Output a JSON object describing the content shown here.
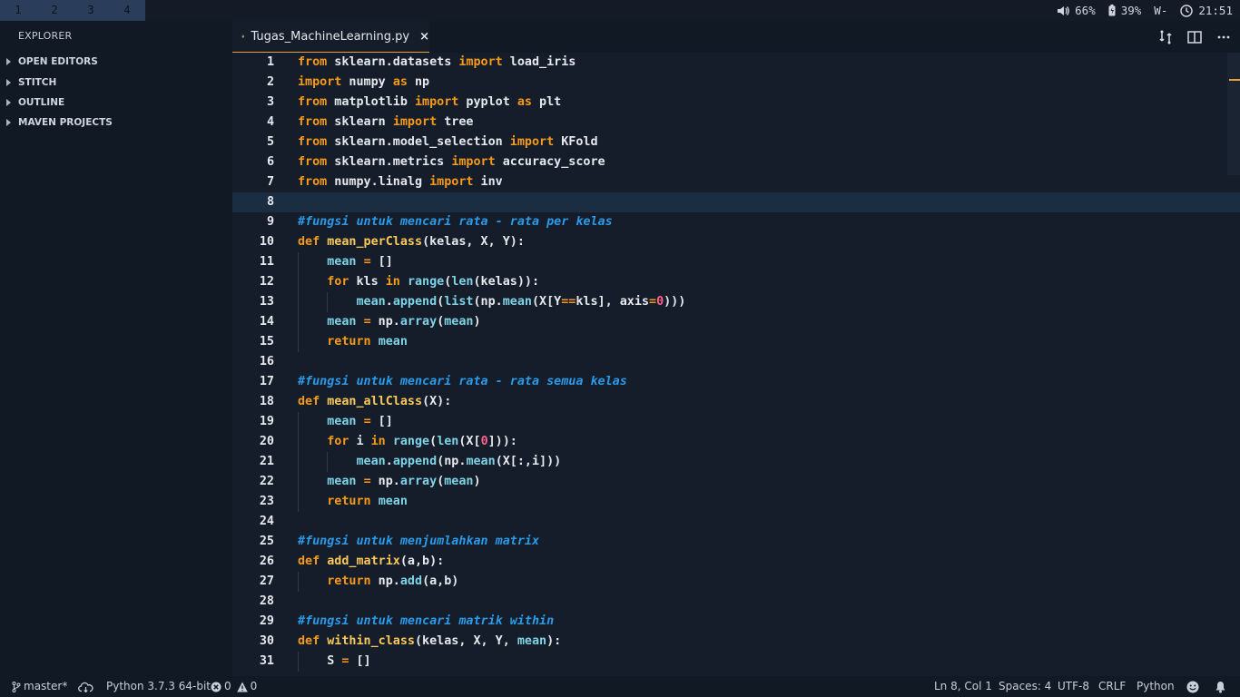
{
  "workspaces": [
    "1",
    "2",
    "3",
    "4"
  ],
  "system": {
    "volume": "66%",
    "battery": "39%",
    "network": "W-",
    "clock": "21:51"
  },
  "sidebar": {
    "title": "EXPLORER",
    "sections": [
      "OPEN EDITORS",
      "STITCH",
      "OUTLINE",
      "MAVEN PROJECTS"
    ]
  },
  "tab": {
    "filename": "Tugas_MachineLearning.py",
    "close": "×"
  },
  "editor": {
    "current_line": 8,
    "lines": [
      "from sklearn.datasets import load_iris",
      "import numpy as np",
      "from matplotlib import pyplot as plt",
      "from sklearn import tree",
      "from sklearn.model_selection import KFold",
      "from sklearn.metrics import accuracy_score",
      "from numpy.linalg import inv",
      "",
      "#fungsi untuk mencari rata - rata per kelas",
      "def mean_perClass(kelas, X, Y):",
      "    mean = []",
      "    for kls in range(len(kelas)):",
      "        mean.append(list(np.mean(X[Y==kls], axis=0)))",
      "    mean = np.array(mean)",
      "    return mean",
      "",
      "#fungsi untuk mencari rata - rata semua kelas",
      "def mean_allClass(X):",
      "    mean = []",
      "    for i in range(len(X[0])):",
      "        mean.append(np.mean(X[:,i]))",
      "    mean = np.array(mean)",
      "    return mean",
      "",
      "#fungsi untuk menjumlahkan matrix",
      "def add_matrix(a,b):",
      "    return np.add(a,b)",
      "",
      "#fungsi untuk mencari matrik within",
      "def within_class(kelas, X, Y, mean):",
      "    S = []"
    ]
  },
  "status": {
    "branch": "master*",
    "interpreter": "Python 3.7.3 64-bit",
    "errors": "0",
    "warnings": "0",
    "cursor": "Ln 8, Col 1",
    "spaces": "Spaces: 4",
    "encoding": "UTF-8",
    "eol": "CRLF",
    "language": "Python"
  }
}
